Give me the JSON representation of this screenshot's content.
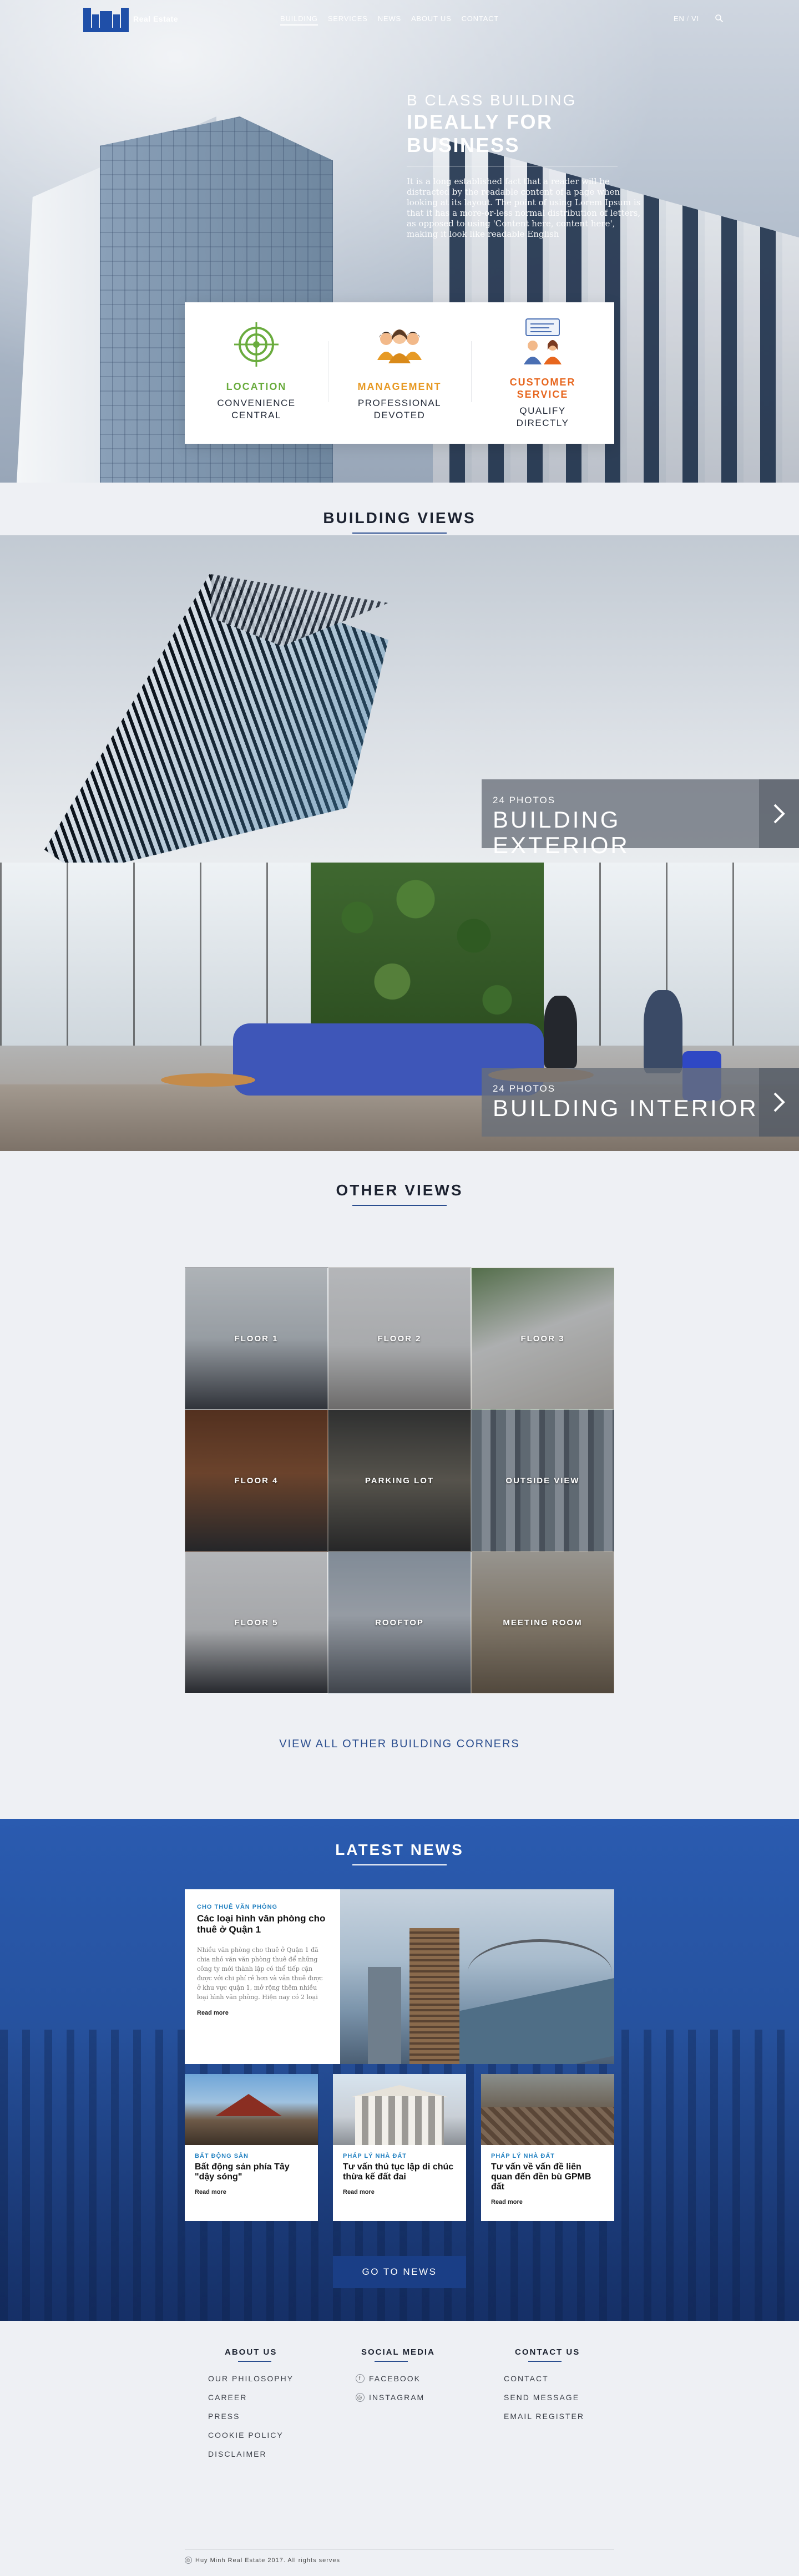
{
  "nav": {
    "brand": "Real Estate",
    "menu": [
      "BUILDING",
      "SERVICES",
      "NEWS",
      "ABOUT US",
      "CONTACT"
    ],
    "active": "BUILDING",
    "lang_en": "EN",
    "lang_sep": "/",
    "lang_vi": "VI",
    "brand_color": "#1f4fa8"
  },
  "hero": {
    "kicker": "B CLASS BUILDING",
    "headline": "IDEALLY FOR BUSINESS",
    "description": "It is a long established fact that a reader will be distracted by the readable content of a page when looking at its layout. The point of using Lorem Ipsum is that it has a more-or-less normal distribution of letters, as opposed to using 'Content here, content here', making it look like readable English"
  },
  "features": [
    {
      "icon": "target-icon",
      "title": "LOCATION",
      "desc1": "CONVENIENCE",
      "desc2": "CENTRAL",
      "color": "#6aac3e"
    },
    {
      "icon": "team-icon",
      "title": "MANAGEMENT",
      "desc1": "PROFESSIONAL",
      "desc2": "DEVOTED",
      "color": "#e79a25"
    },
    {
      "icon": "customer-service-icon",
      "title_line1": "CUSTOMER",
      "title_line2": "SERVICE",
      "desc1": "QUALIFY",
      "desc2": "DIRECTLY",
      "color": "#e7661e"
    }
  ],
  "building_views": {
    "title": "BUILDING VIEWS",
    "exterior": {
      "count": "24 PHOTOS",
      "name": "BUILDING EXTERIOR"
    },
    "interior": {
      "count": "24 PHOTOS",
      "name": "BUILDING INTERIOR"
    }
  },
  "other_views": {
    "title": "OTHER VIEWS",
    "tiles": [
      "FLOOR 1",
      "FLOOR 2",
      "FLOOR 3",
      "FLOOR 4",
      "PARKING LOT",
      "OUTSIDE VIEW",
      "FLOOR 5",
      "ROOFTOP",
      "MEETING ROOM"
    ],
    "view_all": "VIEW ALL OTHER BUILDING CORNERS"
  },
  "news": {
    "title": "LATEST NEWS",
    "featured": {
      "category": "CHO THUÊ VĂN PHÒNG",
      "title": "Các loại hình văn phòng cho thuê ở Quận 1",
      "excerpt": "Nhiều văn phòng cho thuê ở Quận 1 đã chia nhỏ văn văn phòng thuê để những công ty mới thành lập có thể tiếp cận được với chi phí rẻ hơn và vẫn thuê được ở khu vực quận 1, mở rộng thêm nhiều loại hình văn phòng. Hiện nay có 2 loại hình văn phòng ...",
      "readmore": "Read more"
    },
    "items": [
      {
        "category": "BẤT ĐỘNG SẢN",
        "title": "Bất động sản phía Tây \"dậy sóng\"",
        "readmore": "Read more"
      },
      {
        "category": "PHÁP LÝ NHÀ ĐẤT",
        "title": "Tư vấn thủ tục lập di chúc thừa kế đất đai",
        "readmore": "Read more"
      },
      {
        "category": "PHÁP LÝ NHÀ ĐẤT",
        "title": "Tư vấn về vấn đề liên quan đến đền bù GPMB đất",
        "readmore": "Read more"
      }
    ],
    "button": "GO TO NEWS"
  },
  "footer": {
    "about": {
      "title": "ABOUT US",
      "links": [
        "OUR PHILOSOPHY",
        "CAREER",
        "PRESS",
        "COOKIE POLICY",
        "DISCLAIMER"
      ]
    },
    "social": {
      "title": "SOCIAL MEDIA",
      "links": [
        "FACEBOOK",
        "INSTAGRAM"
      ]
    },
    "contact": {
      "title": "CONTACT US",
      "links": [
        "CONTACT",
        "SEND MESSAGE",
        "EMAIL REGISTER"
      ]
    },
    "copyright": "Huy Minh Real Estate 2017. All rights serves"
  }
}
